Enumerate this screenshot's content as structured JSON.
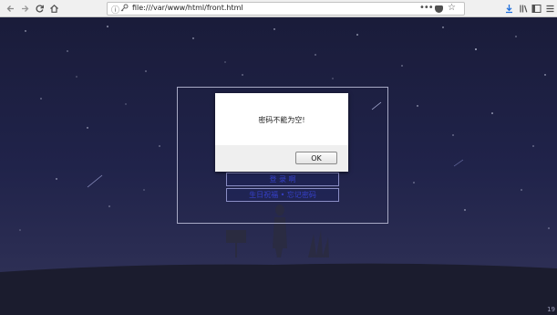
{
  "browser": {
    "url": "file:///var/www/html/front.html",
    "page_actions": "•••",
    "nav": {
      "back_icon": "back-arrow-icon",
      "forward_icon": "forward-arrow-icon",
      "reload_icon": "reload-icon",
      "home_icon": "home-icon"
    },
    "right_icons": [
      "download-icon",
      "library-icon",
      "sidebar-icon",
      "menu-icon"
    ]
  },
  "page": {
    "button_primary": "登 录 啊",
    "button_secondary": "生日祝福 • 忘记密码",
    "corner_text": "19"
  },
  "alert": {
    "message": "密码不能为空!",
    "ok_label": "OK"
  },
  "colors": {
    "sky_top": "#1a1c3a",
    "ground": "#1b1c2e",
    "button_text": "#3640c8"
  }
}
